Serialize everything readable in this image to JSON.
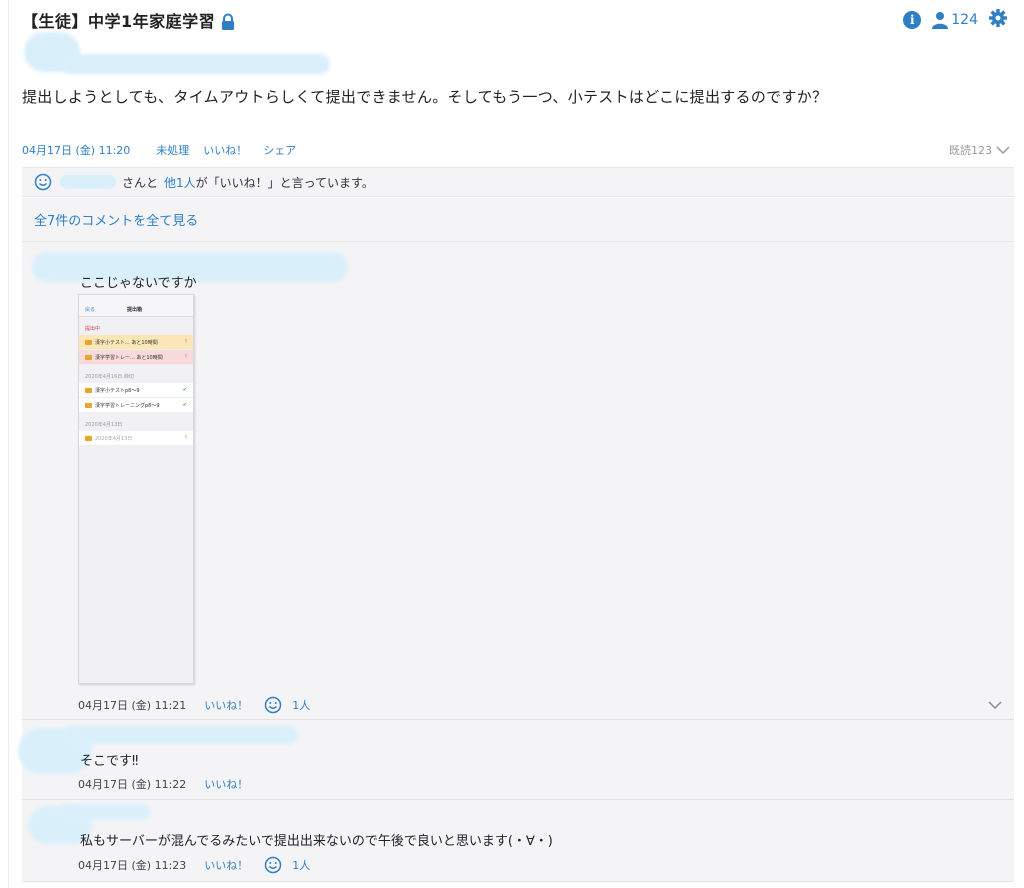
{
  "header": {
    "title": "【生徒】中学1年家庭学習",
    "member_count": "124"
  },
  "post": {
    "body": "提出しようとしても、タイムアウトらしくて提出できません。そしてもう一つ、小テストはどこに提出するのですか？",
    "date": "04月17日 (金) 11:20",
    "status": "未処理",
    "like_label": "いいね！",
    "share_label": "シェア",
    "read_label": "既読123"
  },
  "likes_bar": {
    "suffix": "さんと",
    "others": "他1人",
    "message": "が「いいね！」と言っています。"
  },
  "all_comments_label": "全7件のコメントを全て見る",
  "comments": [
    {
      "text": "ここじゃないですか",
      "date": "04月17日 (金) 11:21",
      "like_label": "いいね！",
      "like_count": "1人"
    },
    {
      "text": "そこです‼",
      "date": "04月17日 (金) 11:22",
      "like_label": "いいね！"
    },
    {
      "text": "私もサーバーが混んでるみたいで提出出来ないので午後で良いと思います(・∀・)",
      "date": "04月17日 (金) 11:23",
      "like_label": "いいね！",
      "like_count": "1人"
    }
  ],
  "screenshot": {
    "back": "戻る",
    "title": "提出箱",
    "section1": "提出中",
    "row1": "漢字小テスト... あと10時間",
    "row2": "漢字学習トレー... あと10時間",
    "section2": "2020年4月16日 締切",
    "row3": "漢字小テストp8〜9",
    "row4": "漢字学習トレーニングp8〜9",
    "section3": "2020年4月13日",
    "row5": "2020年4月13日"
  },
  "colors": {
    "accent": "#2f7fc5",
    "panel": "#f4f4f6",
    "redaction": "#d9f0fb"
  }
}
